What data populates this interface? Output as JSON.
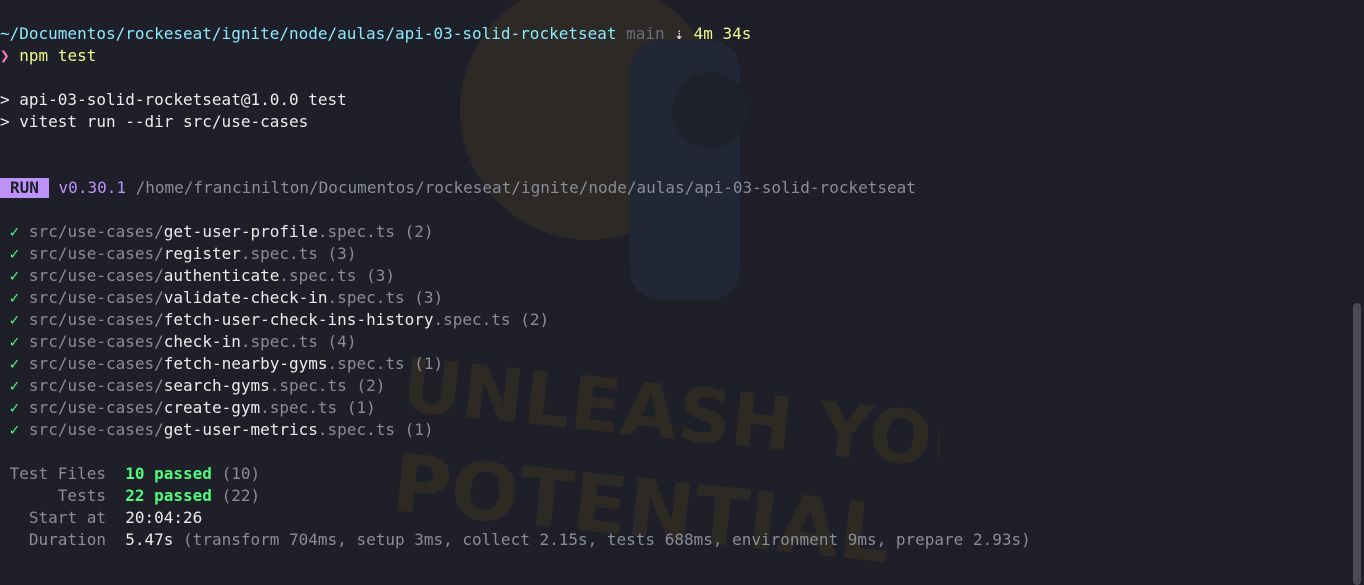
{
  "prompt": {
    "cwd": "~/Documentos/rockeseat/ignite/node/aulas/api-03-solid-rocketseat",
    "branch": "main",
    "duration_icon": "⇣",
    "duration": "4m 34s",
    "symbol": "❯",
    "command_bin": "npm",
    "command_arg": "test"
  },
  "npm_output": {
    "line1": "> api-03-solid-rocketseat@1.0.0 test",
    "line2": "> vitest run --dir src/use-cases"
  },
  "vitest": {
    "badge": "RUN",
    "version": "v0.30.1",
    "root": "/home/francinilton/Documentos/rockeseat/ignite/node/aulas/api-03-solid-rocketseat",
    "check": "✓",
    "dir_prefix": "src/use-cases/",
    "suffix": ".spec.ts",
    "tests": [
      {
        "name": "get-user-profile",
        "count": "(2)"
      },
      {
        "name": "register",
        "count": "(3)"
      },
      {
        "name": "authenticate",
        "count": "(3)"
      },
      {
        "name": "validate-check-in",
        "count": "(3)"
      },
      {
        "name": "fetch-user-check-ins-history",
        "count": "(2)"
      },
      {
        "name": "check-in",
        "count": "(4)"
      },
      {
        "name": "fetch-nearby-gyms",
        "count": "(1)"
      },
      {
        "name": "search-gyms",
        "count": "(2)"
      },
      {
        "name": "create-gym",
        "count": "(1)"
      },
      {
        "name": "get-user-metrics",
        "count": "(1)"
      }
    ]
  },
  "summary": {
    "test_files_label": "Test Files",
    "test_files_passed": "10 passed",
    "test_files_total": "(10)",
    "tests_label": "Tests",
    "tests_passed": "22 passed",
    "tests_total": "(22)",
    "start_label": "Start at",
    "start_value": "20:04:26",
    "duration_label": "Duration",
    "duration_value": "5.47s",
    "duration_detail": "(transform 704ms, setup 3ms, collect 2.15s, tests 688ms, environment 9ms, prepare 2.93s)"
  },
  "watermark": {
    "line1": "UNLEASH YOUR",
    "line2": "POTENTIAL"
  },
  "colors": {
    "background": "#1e1f29",
    "path": "#8be9fd",
    "pass": "#50fa7b",
    "badge": "#bd93f9",
    "muted": "#8a8c99",
    "duration": "#f1fa8c"
  }
}
